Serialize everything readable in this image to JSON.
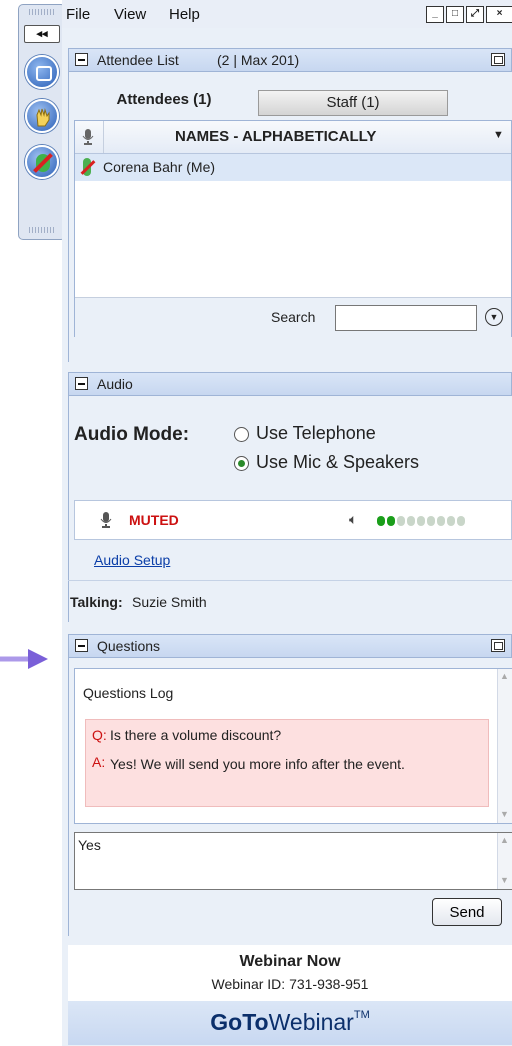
{
  "colors": {
    "accent": "#6a4fd8",
    "muted_red": "#cc1111",
    "link": "#0b3ea8",
    "panel_bg": "#eaf0f8",
    "level_on": "#1a9e1a",
    "level_off": "#c9d6c9"
  },
  "grabtab": {
    "collapse_label": "◂◂",
    "icons": [
      "screen-share-icon",
      "raise-hand-icon",
      "mic-muted-icon"
    ]
  },
  "menubar": {
    "items": [
      "File",
      "View",
      "Help"
    ]
  },
  "attendee_panel": {
    "title": "Attendee List",
    "count": "(2 | Max 201)",
    "tabs": [
      {
        "label": "Attendees (1)"
      },
      {
        "label": "Staff (1)"
      }
    ],
    "column_header": "NAMES - ALPHABETICALLY",
    "rows": [
      {
        "name": "Corena Bahr (Me)"
      }
    ],
    "search_label": "Search",
    "search_value": ""
  },
  "audio_panel": {
    "title": "Audio",
    "mode_label": "Audio Mode:",
    "options": [
      {
        "label": "Use Telephone",
        "selected": false
      },
      {
        "label": "Use Mic & Speakers",
        "selected": true
      }
    ],
    "mic_status": "MUTED",
    "speaker_level": {
      "filled": 2,
      "total": 9
    },
    "setup_link": "Audio Setup",
    "talking_label": "Talking:",
    "talking_name": "Suzie Smith"
  },
  "questions_panel": {
    "title": "Questions",
    "log_title": "Questions Log",
    "q_prefix": "Q:",
    "question": "Is there a volume discount?",
    "a_prefix": "A:",
    "answer": "Yes! We will send you more info after the event.",
    "input_value": "Yes",
    "send_label": "Send"
  },
  "footer": {
    "title": "Webinar Now",
    "id_label": "Webinar ID: 731-938-951",
    "brand_bold": "GoTo",
    "brand_light": "Webinar",
    "brand_tm": "TM"
  }
}
